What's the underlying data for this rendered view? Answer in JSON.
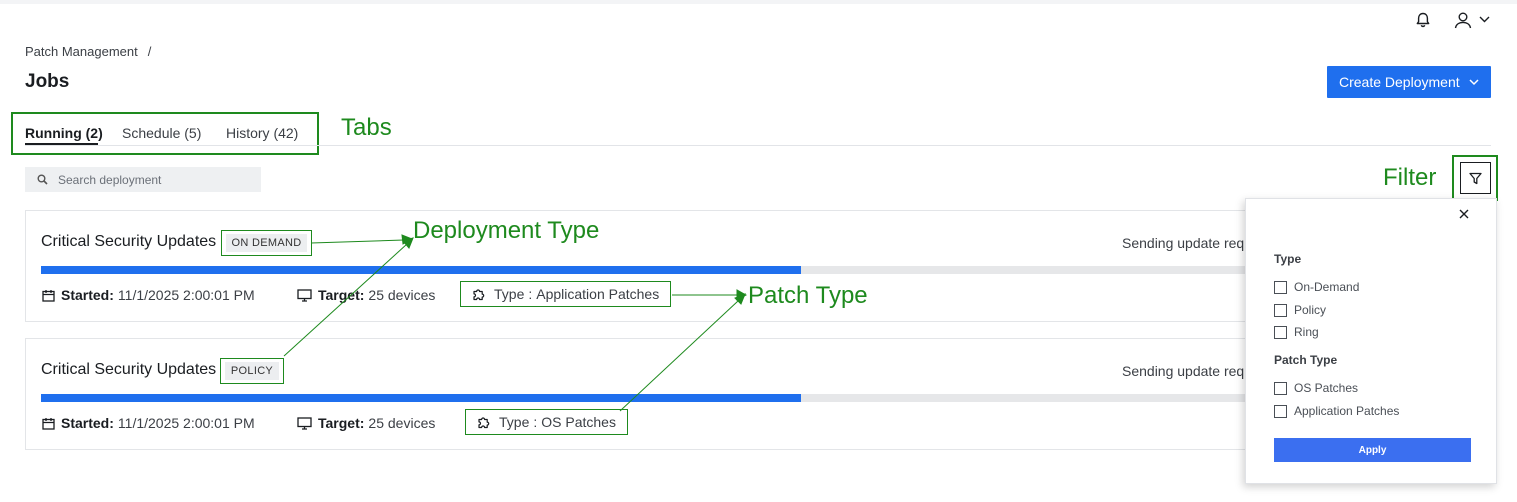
{
  "header": {
    "breadcrumb": "Patch Management",
    "breadcrumb_separator": "/",
    "title": "Jobs",
    "create_button": "Create Deployment",
    "icons": [
      "bell-icon",
      "user-icon",
      "chevron-down-icon"
    ]
  },
  "tabs": [
    {
      "label": "Running (2)",
      "active": true
    },
    {
      "label": "Schedule (5)",
      "active": false
    },
    {
      "label": "History (42)",
      "active": false
    }
  ],
  "search": {
    "placeholder": "Search deployment"
  },
  "annotations": {
    "tabs": "Tabs",
    "filter": "Filter",
    "deployment_type": "Deployment Type",
    "patch_type": "Patch Type"
  },
  "deployments": [
    {
      "title": "Critical Security Updates",
      "badge": "ON DEMAND",
      "status": "Sending update requ",
      "progress": 0.62,
      "started_label": "Started:",
      "started": "11/1/2025 2:00:01 PM",
      "target_label": "Target:",
      "target": "25 devices",
      "type_label": "Type",
      "type_sep": ":",
      "type": "Application Patches"
    },
    {
      "title": "Critical Security Updates",
      "badge": "POLICY",
      "status": "Sending update requ",
      "progress": 0.62,
      "started_label": "Started:",
      "started": "11/1/2025 2:00:01 PM",
      "target_label": "Target:",
      "target": "25 devices",
      "type_label": "Type",
      "type_sep": ":",
      "type": "OS Patches"
    }
  ],
  "filter_panel": {
    "type_heading": "Type",
    "type_options": [
      "On-Demand",
      "Policy",
      "Ring"
    ],
    "patch_type_heading": "Patch Type",
    "patch_type_options": [
      "OS Patches",
      "Application Patches"
    ],
    "apply": "Apply"
  },
  "colors": {
    "accent": "#1f6fee",
    "annotation": "#1e8a1e",
    "track": "#e6e7e9"
  }
}
